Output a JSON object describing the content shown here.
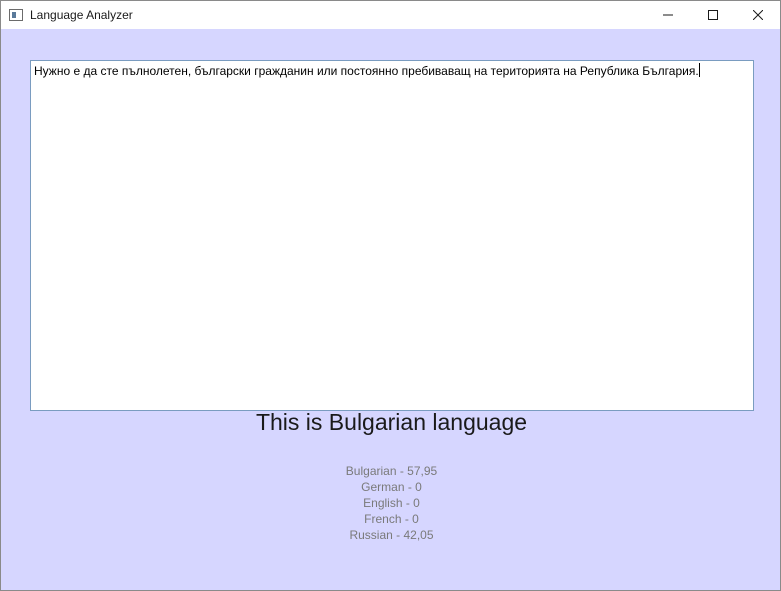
{
  "window": {
    "title": "Language Analyzer",
    "icon": "app-window-icon",
    "controls": [
      "minimize-icon",
      "maximize-icon",
      "close-icon"
    ]
  },
  "input": {
    "text": "Нужно е да сте пълнолетен, български гражданин или постоянно пребиваващ на територията на Република България."
  },
  "result": {
    "title": "This is Bulgarian language"
  },
  "scores": [
    {
      "text": "Bulgarian - 57,95"
    },
    {
      "text": "German - 0"
    },
    {
      "text": "English - 0"
    },
    {
      "text": "French - 0"
    },
    {
      "text": "Russian - 42,05"
    }
  ],
  "colors": {
    "background": "#d6d6ff",
    "input_border": "#7a9cc0",
    "score_text": "#7a7a7a"
  }
}
